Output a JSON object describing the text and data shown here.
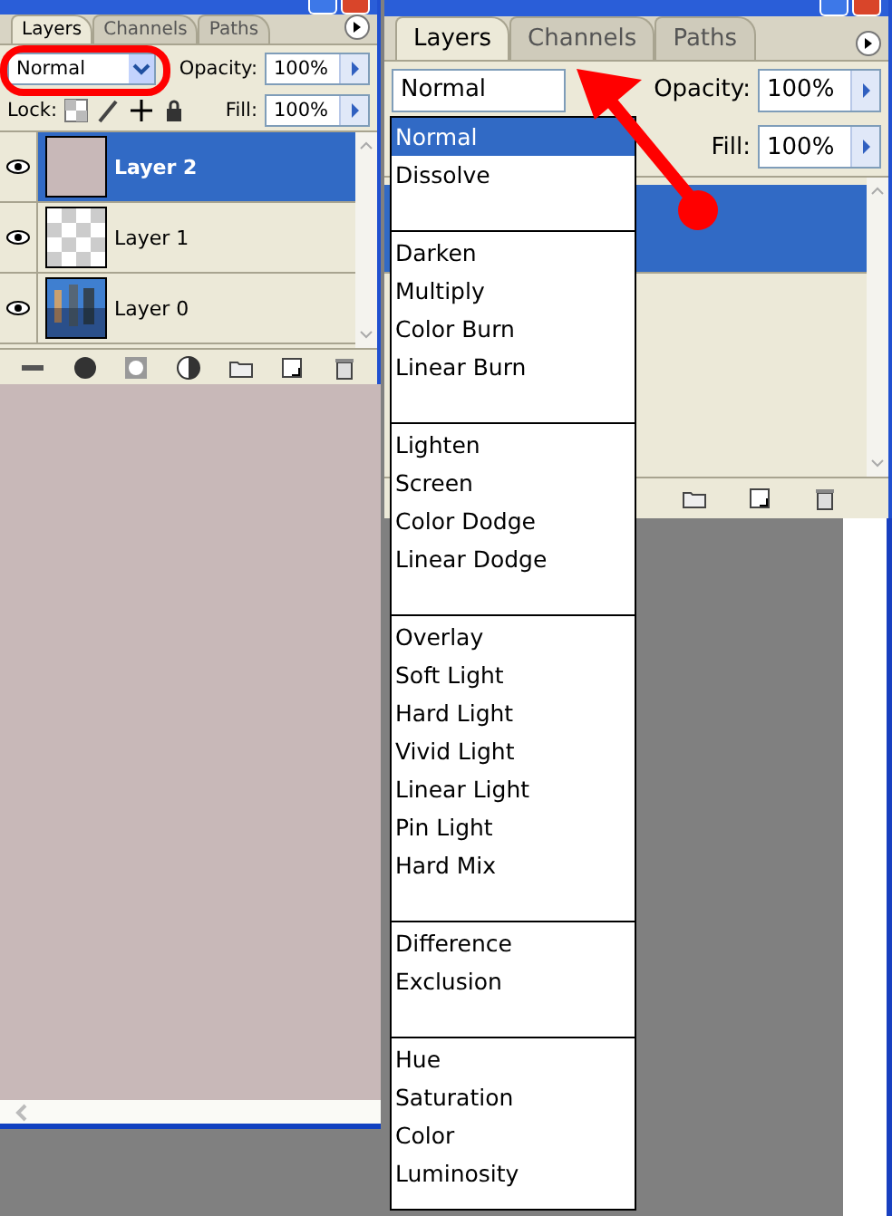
{
  "left_panel": {
    "tabs": [
      {
        "label": "Layers",
        "selected": true
      },
      {
        "label": "Channels",
        "selected": false
      },
      {
        "label": "Paths",
        "selected": false
      }
    ],
    "blend_mode": "Normal",
    "opacity_label": "Opacity:",
    "opacity": "100%",
    "lock_label": "Lock:",
    "fill_label": "Fill:",
    "fill": "100%",
    "layers": [
      {
        "name": "Layer 2",
        "selected": true,
        "visible": true,
        "kind": "solid"
      },
      {
        "name": "Layer 1",
        "selected": false,
        "visible": true,
        "kind": "transparent"
      },
      {
        "name": "Layer 0",
        "selected": false,
        "visible": true,
        "kind": "picture"
      }
    ]
  },
  "right_panel": {
    "tabs": [
      {
        "label": "Layers",
        "selected": true
      },
      {
        "label": "Channels",
        "selected": false
      },
      {
        "label": "Paths",
        "selected": false
      }
    ],
    "blend_mode": "Normal",
    "opacity_label": "Opacity:",
    "opacity": "100%",
    "fill_label": "Fill:",
    "fill": "100%"
  },
  "blend_menu": {
    "groups": [
      [
        {
          "label": "Normal",
          "selected": true
        },
        {
          "label": "Dissolve",
          "selected": false
        }
      ],
      [
        {
          "label": "Darken",
          "selected": false
        },
        {
          "label": "Multiply",
          "selected": false
        },
        {
          "label": "Color Burn",
          "selected": false
        },
        {
          "label": "Linear Burn",
          "selected": false
        }
      ],
      [
        {
          "label": "Lighten",
          "selected": false
        },
        {
          "label": "Screen",
          "selected": false
        },
        {
          "label": "Color Dodge",
          "selected": false
        },
        {
          "label": "Linear Dodge",
          "selected": false
        }
      ],
      [
        {
          "label": "Overlay",
          "selected": false
        },
        {
          "label": "Soft Light",
          "selected": false
        },
        {
          "label": "Hard Light",
          "selected": false
        },
        {
          "label": "Vivid Light",
          "selected": false
        },
        {
          "label": "Linear Light",
          "selected": false
        },
        {
          "label": "Pin Light",
          "selected": false
        },
        {
          "label": "Hard Mix",
          "selected": false
        }
      ],
      [
        {
          "label": "Difference",
          "selected": false
        },
        {
          "label": "Exclusion",
          "selected": false
        }
      ],
      [
        {
          "label": "Hue",
          "selected": false
        },
        {
          "label": "Saturation",
          "selected": false
        },
        {
          "label": "Color",
          "selected": false
        },
        {
          "label": "Luminosity",
          "selected": false
        }
      ]
    ]
  }
}
